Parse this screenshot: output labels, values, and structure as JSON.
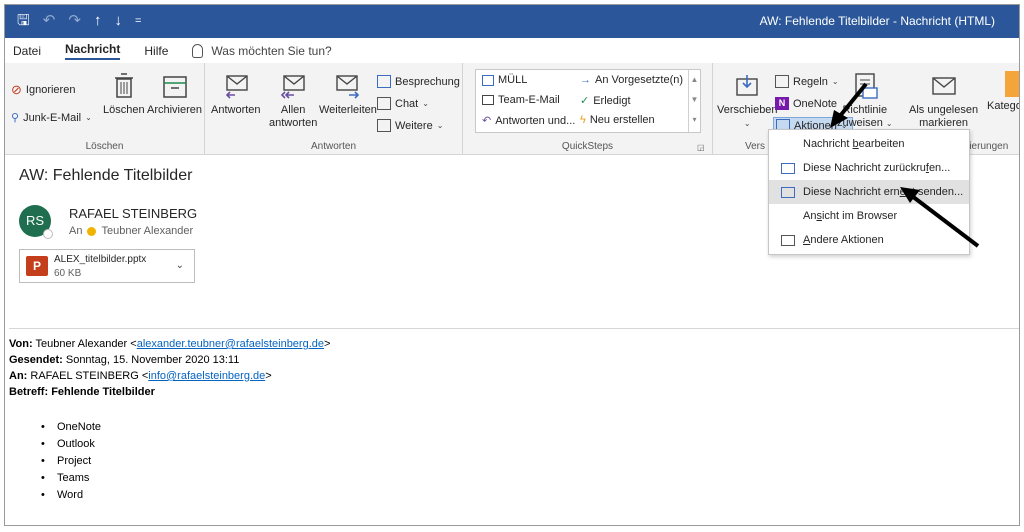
{
  "titlebar": {
    "quick_access": [
      "🖫",
      "↶",
      "↷",
      "↑",
      "↓",
      "="
    ],
    "window_title": "AW: Fehlende Titelbilder  -  Nachricht (HTML)",
    "color": "#2b579a"
  },
  "tabs": {
    "items": [
      "Datei",
      "Nachricht",
      "Hilfe"
    ],
    "active": "Nachricht",
    "tell_me": "Was möchten Sie tun?"
  },
  "ribbon": {
    "loeschen": {
      "ignore": "Ignorieren",
      "junk": "Junk-E-Mail",
      "delete": "Löschen",
      "archive": "Archivieren",
      "label": "Löschen"
    },
    "antworten": {
      "reply": "Antworten",
      "reply_all_1": "Allen",
      "reply_all_2": "antworten",
      "forward": "Weiterleiten",
      "meeting": "Besprechung",
      "chat": "Chat",
      "more": "Weitere",
      "label": "Antworten"
    },
    "quicksteps": {
      "items": [
        "MÜLL",
        "Team-E-Mail",
        "Antworten und...",
        "An Vorgesetzte(n)",
        "Erledigt",
        "Neu erstellen"
      ],
      "label": "QuickSteps"
    },
    "verschieben": {
      "move": "Verschieben",
      "rules": "Regeln",
      "onenote": "OneNote",
      "actions": "Aktionen",
      "label": "Vers",
      "policy_1": "Richtlinie",
      "policy_2": "zuweisen",
      "unread_1": "Als ungelesen",
      "unread_2": "markieren",
      "categorize": "Kategor",
      "label2": "rkierungen"
    }
  },
  "message": {
    "subject": "AW: Fehlende Titelbilder",
    "avatar_initials": "RS",
    "avatar_color": "#1f6e4f",
    "sender": "RAFAEL STEINBERG",
    "to_prefix": "An",
    "to_name": "Teubner Alexander",
    "attachment": {
      "name": "ALEX_titelbilder.pptx",
      "size": "60 KB"
    }
  },
  "body": {
    "from_label": "Von:",
    "from_name": "Teubner Alexander <",
    "from_email": "alexander.teubner@rafaelsteinberg.de",
    "from_close": ">",
    "sent_label": "Gesendet:",
    "sent_value": "Sonntag, 15. November 2020 13:11",
    "to_label": "An:",
    "to_name": "RAFAEL STEINBERG <",
    "to_email": "info@rafaelsteinberg.de",
    "to_close": ">",
    "subject_label": "Betreff:",
    "subject_value": "Fehlende Titelbilder",
    "bullets": [
      "OneNote",
      "Outlook",
      "Project",
      "Teams",
      "Word"
    ]
  },
  "menu": {
    "items": [
      {
        "pre": "Nachricht ",
        "u": "b",
        "post": "earbeiten"
      },
      {
        "pre": "Diese Nachricht zurückru",
        "u": "f",
        "post": "en..."
      },
      {
        "pre": "Diese Nachricht ern",
        "u": "e",
        "post": "ut senden..."
      },
      {
        "pre": "An",
        "u": "s",
        "post": "icht im Browser"
      },
      {
        "pre": "",
        "u": "A",
        "post": "ndere Aktionen"
      }
    ]
  }
}
